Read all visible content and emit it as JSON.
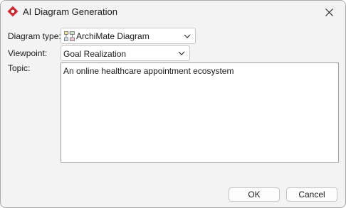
{
  "window": {
    "title": "AI Diagram Generation",
    "accent_color": "#d9323a"
  },
  "form": {
    "diagram_type": {
      "label": "Diagram type:",
      "value": "ArchiMate Diagram",
      "icon": "archimate-diagram-icon"
    },
    "viewpoint": {
      "label": "Viewpoint:",
      "value": "Goal Realization"
    },
    "topic": {
      "label": "Topic:",
      "value": "An online healthcare appointment ecosystem"
    }
  },
  "buttons": {
    "ok": "OK",
    "cancel": "Cancel"
  }
}
